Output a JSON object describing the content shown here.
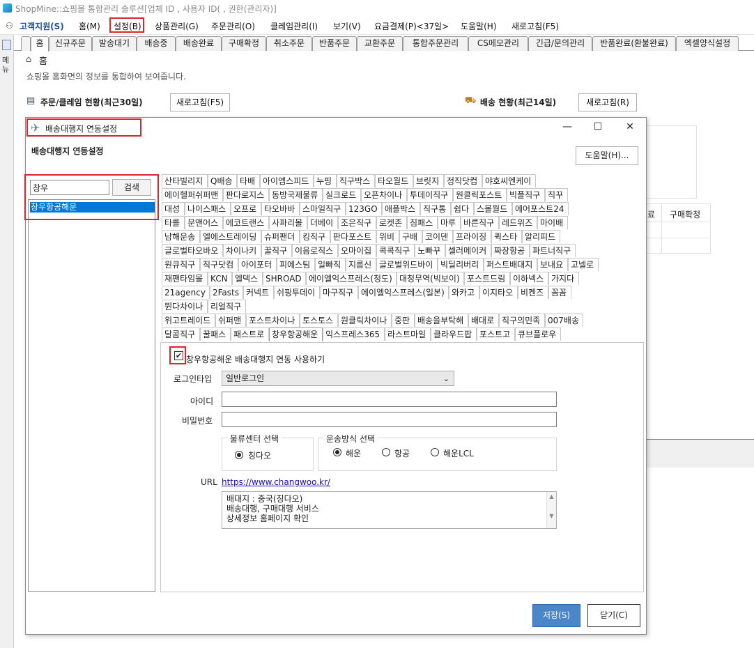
{
  "window": {
    "title": "ShopMine::쇼핑몰 통합관리 솔루션[업체 ID                , 사용자 ID(                   , 권한(관리자)]"
  },
  "menubar": {
    "items": [
      "고객지원(S)",
      "홈(M)",
      "설정(B)",
      "상품관리(G)",
      "주문관리(O)",
      "클레임관리(I)",
      "보기(V)",
      "요금결제(P)<37일>",
      "도움말(H)",
      "새로고침(F5)"
    ]
  },
  "sidemenu": {
    "label": "메뉴"
  },
  "tabs": [
    "홈",
    "신규주문",
    "발송대기",
    "배송중",
    "배송완료",
    "구매확정",
    "취소주문",
    "반품주문",
    "교환주문",
    "통합주문관리",
    "CS메모관리",
    "긴급/문의관리",
    "반품완료(환불완료)",
    "엑셀양식설정"
  ],
  "home": {
    "crumb": "홈",
    "desc": "쇼핑몰 홈화면의 정보를 통합하여 보여줍니다.",
    "order_title": "주문/클레임 현황(최근30일)",
    "order_refresh": "새로고침(F5)",
    "ship_title": "배송 현황(최근14일)",
    "ship_refresh": "새로고침(R)",
    "bg_cols": [
      "료",
      "구매확정"
    ]
  },
  "dialog": {
    "title": "배송대행지 연동설정",
    "header": "배송대행지 연동설정",
    "help": "도움말(H)...",
    "search_value": "창우",
    "search_btn": "검색",
    "result": "창우항공해운",
    "carrier_rows": [
      [
        "산타빌리지",
        "Q배송",
        "타배",
        "아이엠스피드",
        "누핑",
        "직구박스",
        "타오월드",
        "브릿지",
        "정직닷컴",
        "야호씨엔케이"
      ],
      [
        "에이헬퍼쉬퍼맨",
        "판다로지스",
        "동방국제물류",
        "실크로드",
        "오픈차이나",
        "투데이직구",
        "원클릭포스트",
        "빅플직구",
        "직꾸"
      ],
      [
        "대성",
        "나이스패스",
        "오프로",
        "타오바바",
        "스마일직구",
        "123GO",
        "애플박스",
        "직구통",
        "쉽다",
        "스몰월드",
        "에어포스트24"
      ],
      [
        "타를",
        "문앤어스",
        "에코트랜스",
        "사파리몰",
        "더베이",
        "조은직구",
        "로켓존",
        "짐패스",
        "마루",
        "바른직구",
        "레드위즈",
        "마이배"
      ],
      [
        "남해운송",
        "엘에스트레이딩",
        "슈퍼팬더",
        "킹직구",
        "판다포스트",
        "위비",
        "구배",
        "코이덴",
        "프라이징",
        "퀵스타",
        "알리피드"
      ],
      [
        "글로벌타오바오",
        "차이나키",
        "꿀직구",
        "이음로직스",
        "오마이집",
        "콕콕직구",
        "노빠꾸",
        "셀러메이커",
        "짜장항공",
        "파트너직구"
      ],
      [
        "원큐직구",
        "직구닷컴",
        "아이포터",
        "피에스팀",
        "일빠직",
        "지름신",
        "글로벌위드바이",
        "빅딜리버리",
        "퍼스트배대지",
        "보내요",
        "고넬로"
      ],
      [
        "재팬타임몰",
        "KCN",
        "엘덱스",
        "SHROAD",
        "에이엘익스프레스(청도)",
        "대청무역(빅보이)",
        "포스트드림",
        "이하넥스",
        "가지다"
      ],
      [
        "21agency",
        "2Fasts",
        "커넥트",
        "쉬핑투데이",
        "마구직구",
        "에이엘익스프레스(일본)",
        "와카고",
        "이지타오",
        "비켄즈",
        "꼼꼼"
      ],
      [
        "뛴다차이나",
        "리얼직구"
      ],
      [
        "위고트레이드",
        "쉬퍼맨",
        "포스트차이나",
        "토스토스",
        "원클릭차이나",
        "중판",
        "배송을부탁해",
        "배대로",
        "직구의민족",
        "007배송"
      ],
      [
        "달콤직구",
        "꿀패스",
        "패스트로",
        "창우항공해운",
        "익스프레스365",
        "라스트마일",
        "클라우드팝",
        "포스트고",
        "큐브플로우"
      ]
    ],
    "active_carrier": "창우항공해운",
    "use_label": "창우항공해운 배송대행지 연동 사용하기",
    "login_type_label": "로그인타입",
    "login_type_value": "일반로그인",
    "id_label": "아이디",
    "pw_label": "비밀번호",
    "center_group": "물류센터 선택",
    "center_option": "칭다오",
    "ship_group": "운송방식 선택",
    "ship_options": [
      "해운",
      "항공",
      "해운LCL"
    ],
    "url_label": "URL",
    "url": "https://www.changwoo.kr/",
    "memo": [
      "배대지 : 중국(칭다오)",
      "배송대행, 구매대행 서비스",
      "상세정보 홈페이지 확인"
    ],
    "save": "저장(S)",
    "close": "닫기(C)"
  }
}
